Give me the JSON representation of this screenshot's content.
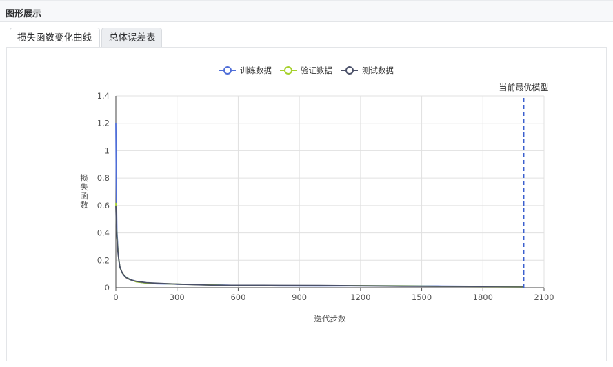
{
  "header": {
    "title": "图形展示"
  },
  "tabs": [
    {
      "label": "损失函数变化曲线",
      "active": true
    },
    {
      "label": "总体误差表",
      "active": false
    }
  ],
  "chart_data": {
    "type": "line",
    "xlabel": "迭代步数",
    "ylabel": "损失函数",
    "xlim": [
      0,
      2100
    ],
    "ylim": [
      0,
      1.4
    ],
    "xticks": [
      0,
      300,
      600,
      900,
      1200,
      1500,
      1800,
      2100
    ],
    "yticks": [
      0,
      0.2,
      0.4,
      0.6,
      0.8,
      1,
      1.2,
      1.4
    ],
    "grid": true,
    "legend_position": "top-center",
    "marker_annotation": {
      "label": "当前最优模型",
      "x": 2000,
      "style": "dashed",
      "color": "#3b5fce"
    },
    "series": [
      {
        "name": "训练数据",
        "color": "#4f6ed8",
        "x": [
          0,
          2,
          5,
          10,
          15,
          20,
          30,
          40,
          50,
          70,
          100,
          150,
          200,
          300,
          400,
          500,
          600,
          800,
          1000,
          1200,
          1400,
          1600,
          1800,
          2000
        ],
        "y": [
          1.2,
          0.75,
          0.42,
          0.28,
          0.2,
          0.15,
          0.11,
          0.09,
          0.075,
          0.06,
          0.045,
          0.035,
          0.03,
          0.025,
          0.022,
          0.02,
          0.018,
          0.016,
          0.014,
          0.013,
          0.012,
          0.011,
          0.011,
          0.01
        ]
      },
      {
        "name": "验证数据",
        "color": "#a7d12e",
        "x": [
          0,
          2,
          5,
          10,
          15,
          20,
          30,
          40,
          50,
          70,
          100,
          150,
          200,
          300,
          400,
          500,
          600,
          800,
          1000,
          1200,
          1400,
          1600,
          1800,
          2000
        ],
        "y": [
          0.62,
          0.5,
          0.38,
          0.27,
          0.2,
          0.15,
          0.11,
          0.09,
          0.075,
          0.06,
          0.045,
          0.035,
          0.03,
          0.025,
          0.022,
          0.02,
          0.018,
          0.016,
          0.014,
          0.013,
          0.012,
          0.011,
          0.011,
          0.01
        ]
      },
      {
        "name": "测试数据",
        "color": "#4a5068",
        "x": [
          0,
          2,
          5,
          10,
          15,
          20,
          30,
          40,
          50,
          70,
          100,
          150,
          200,
          300,
          400,
          500,
          600,
          800,
          1000,
          1200,
          1400,
          1600,
          1800,
          2000
        ],
        "y": [
          0.6,
          0.48,
          0.37,
          0.26,
          0.2,
          0.15,
          0.11,
          0.09,
          0.075,
          0.06,
          0.047,
          0.036,
          0.031,
          0.026,
          0.023,
          0.02,
          0.019,
          0.017,
          0.015,
          0.013,
          0.012,
          0.012,
          0.011,
          0.01
        ]
      }
    ]
  }
}
